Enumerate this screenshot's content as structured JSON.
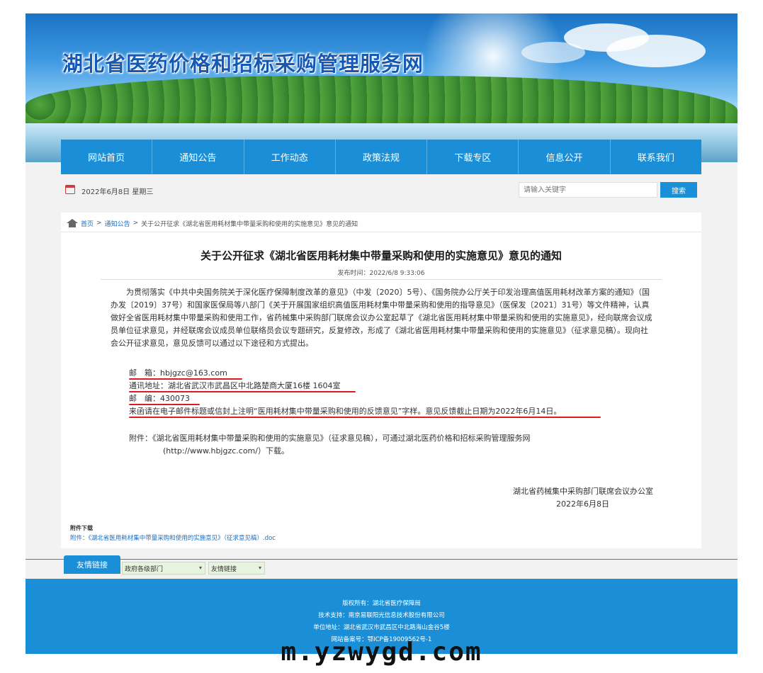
{
  "site": {
    "title": "湖北省医药价格和招标采购管理服务网"
  },
  "nav": {
    "items": [
      "网站首页",
      "通知公告",
      "工作动态",
      "政策法规",
      "下载专区",
      "信息公开",
      "联系我们"
    ]
  },
  "datebar": {
    "date": "2022年6月8日 星期三",
    "search_placeholder": "请输入关键字",
    "search_button": "搜索"
  },
  "breadcrumb": {
    "home": "首页",
    "sep": ">",
    "section": "通知公告",
    "current": "关于公开征求《湖北省医用耗材集中带量采购和使用的实施意见》意见的通知"
  },
  "article": {
    "title": "关于公开征求《湖北省医用耗材集中带量采购和使用的实施意见》意见的通知",
    "pubtime": "发布时间：2022/6/8 9:33:06",
    "paragraph": "为贯彻落实《中共中央国务院关于深化医疗保障制度改革的意见》（中发〔2020〕5号）、《国务院办公厅关于印发治理高值医用耗材改革方案的通知》（国办发〔2019〕37号）和国家医保局等八部门《关于开展国家组织高值医用耗材集中带量采购和使用的指导意见》（医保发〔2021〕31号）等文件精神，认真做好全省医用耗材集中带量采购和使用工作，省药械集中采购部门联席会议办公室起草了《湖北省医用耗材集中带量采购和使用的实施意见》，经向联席会议成员单位征求意见，并经联席会议成员单位联络员会议专题研究，反复修改，形成了《湖北省医用耗材集中带量采购和使用的实施意见》（征求意见稿）。现向社会公开征求意见，意见反馈可以通过以下途径和方式提出。",
    "email": "邮　箱：hbjgzc@163.com",
    "address": "通讯地址：湖北省武汉市武昌区中北路楚商大厦16楼 1604室",
    "postcode": "邮　编：430073",
    "note": "来函请在电子邮件标题或信封上注明“医用耗材集中带量采购和使用的反馈意见”字样。意见反馈截止日期为2022年6月14日。",
    "attachment_text": "附件：《湖北省医用耗材集中带量采购和使用的实施意见》（征求意见稿），可通过湖北医药价格和招标采购管理服务网",
    "attachment_url": "(http://www.hbjgzc.com/）下载。",
    "sign_org": "湖北省药械集中采购部门联席会议办公室",
    "sign_date": "2022年6月8日",
    "download_title": "附件下载",
    "download_link": "附件：《湖北省医用耗材集中带量采购和使用的实施意见》（征求意见稿）.doc"
  },
  "links": {
    "tab": "友情链接",
    "select1": "政府各级部门",
    "select2": "友情链接"
  },
  "footer": {
    "copyright": "版权所有：湖北省医疗保障局",
    "support": "技术支持：南京易联阳光信息技术股份有限公司",
    "address": "单位地址：湖北省武汉市武昌区中北路海山金谷5楼",
    "icp": "网站备案号：鄂ICP备19009562号-1"
  },
  "watermark": "m.yzwygd.com",
  "colors": {
    "brand_blue": "#1a8fd8",
    "title_blue": "#1659b5",
    "annotation_red": "#d42020"
  }
}
